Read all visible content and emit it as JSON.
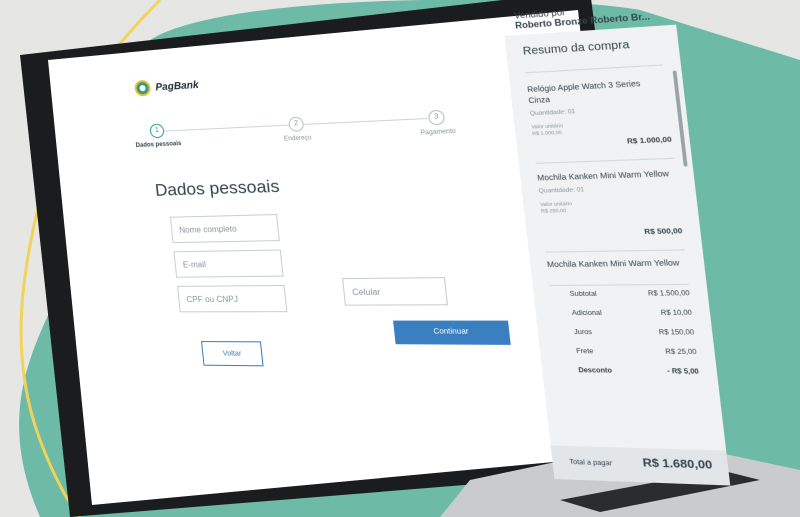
{
  "logo": {
    "text": "PagBank"
  },
  "stepper": {
    "steps": [
      {
        "number": "1",
        "label": "Dados pessoais"
      },
      {
        "number": "2",
        "label": "Endereço"
      },
      {
        "number": "3",
        "label": "Pagamento"
      }
    ]
  },
  "form": {
    "title": "Dados pessoais",
    "fields": {
      "name_placeholder": "Nome completo",
      "email_placeholder": "E-mail",
      "doc_placeholder": "CPF ou CNPJ",
      "phone_placeholder": "Celular"
    },
    "continue_label": "Continuar",
    "back_label": "Voltar"
  },
  "seller": {
    "prefix": "Vendido por",
    "name": "Roberto Bronze Roberto Br..."
  },
  "summary": {
    "title": "Resumo da compra",
    "items": [
      {
        "name": "Relógio Apple Watch 3 Series Cinza",
        "qty": "Quantidade: 01",
        "unit_label": "Valor unitário",
        "unit_value": "R$ 1.000,00",
        "price": "R$ 1.000,00"
      },
      {
        "name": "Mochila Kanken Mini Warm Yellow",
        "qty": "Quantidade: 01",
        "unit_label": "Valor unitário",
        "unit_value": "R$ 250,00",
        "price": "R$ 500,00"
      },
      {
        "name": "Mochila Kanken Mini Warm Yellow",
        "qty": "",
        "unit_label": "",
        "unit_value": "",
        "price": ""
      }
    ],
    "totals": [
      {
        "label": "Subtotal",
        "value": "R$ 1.500,00"
      },
      {
        "label": "Adicional",
        "value": "R$ 10,00"
      },
      {
        "label": "Juros",
        "value": "R$ 150,00"
      },
      {
        "label": "Frete",
        "value": "R$ 25,00"
      },
      {
        "label": "Desconto",
        "value": "- R$ 5,00"
      }
    ],
    "total_label": "Total a pagar",
    "total_value": "R$ 1.680,00"
  },
  "colors": {
    "accent": "#3a7fc0",
    "brand_green": "#2f9e86",
    "background_green": "#6dbaa6",
    "yellow_line": "#f2d35a"
  }
}
